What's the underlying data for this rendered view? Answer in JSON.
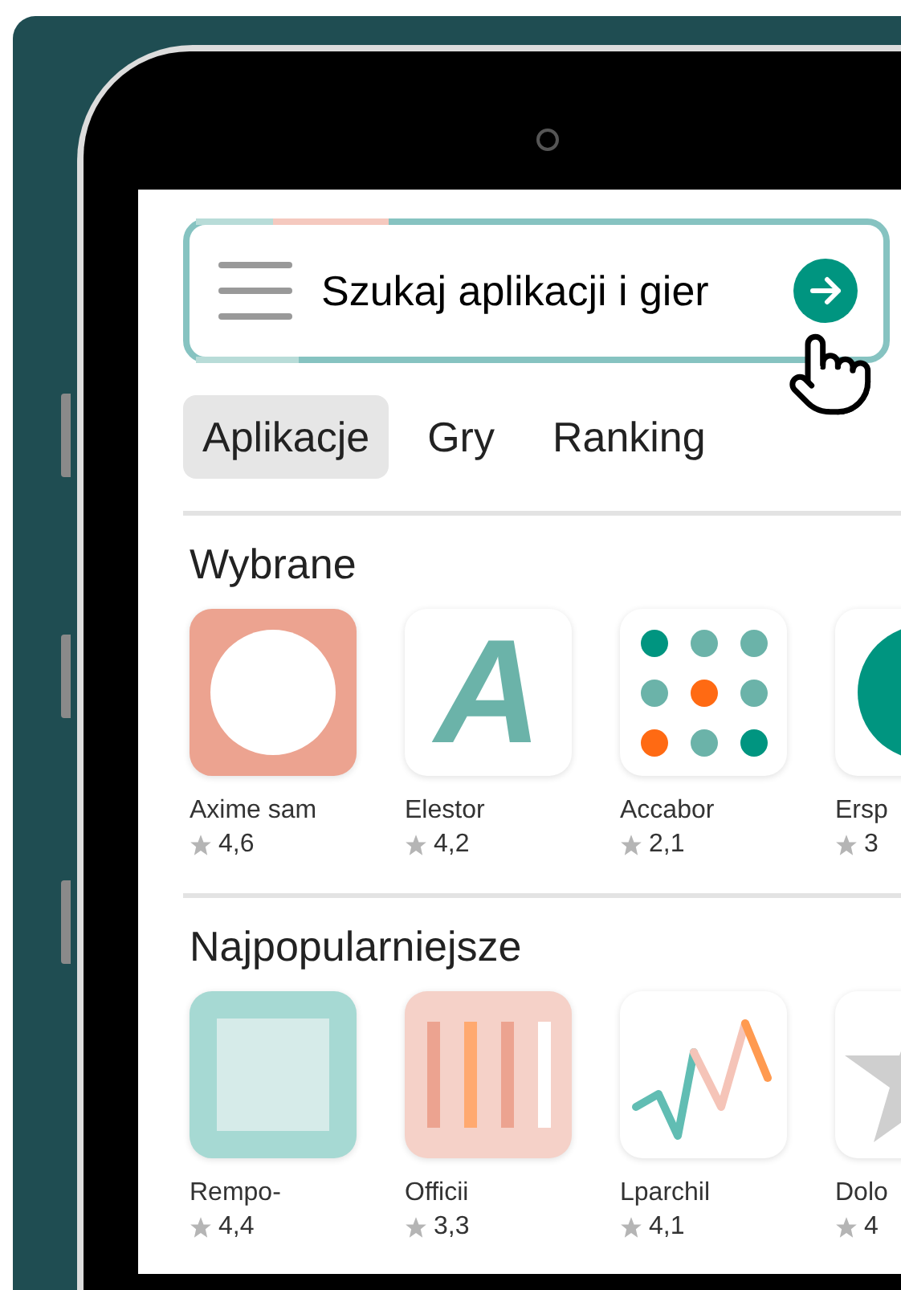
{
  "search": {
    "placeholder": "Szukaj aplikacji i gier"
  },
  "tabs": [
    {
      "label": "Aplikacje",
      "selected": true
    },
    {
      "label": "Gry",
      "selected": false
    },
    {
      "label": "Ranking",
      "selected": false
    }
  ],
  "sections": [
    {
      "title": "Wybrane",
      "apps": [
        {
          "name": "Axime sam",
          "rating": "4,6",
          "icon": {
            "kind": "circle"
          }
        },
        {
          "name": "Elestor",
          "rating": "4,2",
          "icon": {
            "kind": "letter",
            "letter": "A"
          }
        },
        {
          "name": "Accabor",
          "rating": "2,1",
          "icon": {
            "kind": "dots"
          }
        },
        {
          "name": "Ersp",
          "rating": "3",
          "icon": {
            "kind": "disc"
          }
        }
      ]
    },
    {
      "title": "Najpopularniejsze",
      "apps": [
        {
          "name": "Rempo-",
          "rating": "4,4",
          "icon": {
            "kind": "square"
          }
        },
        {
          "name": "Officii",
          "rating": "3,3",
          "icon": {
            "kind": "bars"
          }
        },
        {
          "name": "Lparchil",
          "rating": "4,1",
          "icon": {
            "kind": "zigzag"
          }
        },
        {
          "name": "Dolo",
          "rating": "4",
          "icon": {
            "kind": "star"
          }
        }
      ]
    }
  ]
}
